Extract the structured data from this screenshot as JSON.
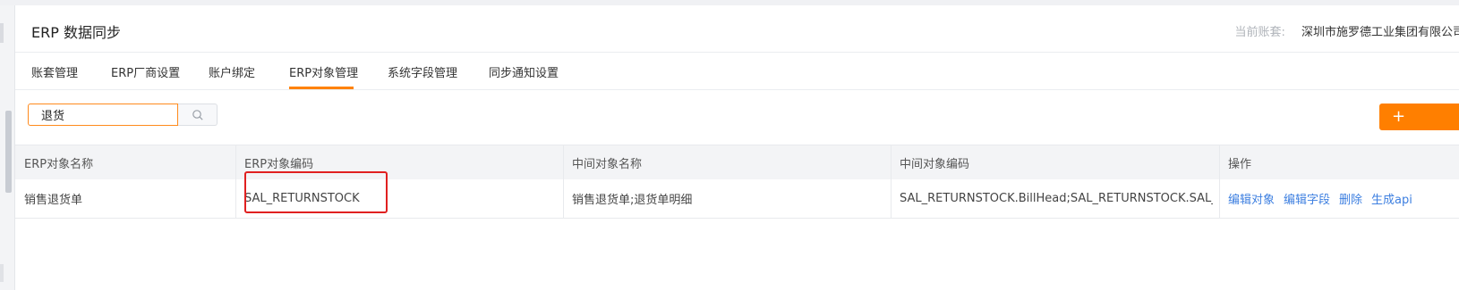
{
  "header": {
    "title": "ERP 数据同步",
    "account_label": "当前账套:",
    "account_value": "深圳市施罗德工业集团有限公司"
  },
  "tabs": [
    {
      "label": "账套管理"
    },
    {
      "label": "ERP厂商设置"
    },
    {
      "label": "账户绑定"
    },
    {
      "label": "ERP对象管理",
      "active": true
    },
    {
      "label": "系统字段管理"
    },
    {
      "label": "同步通知设置"
    }
  ],
  "search": {
    "value": "退货",
    "icon": "search-icon"
  },
  "add_button": {
    "label": "+"
  },
  "table": {
    "columns": [
      "ERP对象名称",
      "ERP对象编码",
      "中间对象名称",
      "中间对象编码",
      "操作"
    ],
    "rows": [
      {
        "erp_name": "销售退货单",
        "erp_code": "SAL_RETURNSTOCK",
        "mid_name": "销售退货单;退货单明细",
        "mid_code": "SAL_RETURNSTOCK.BillHead;SAL_RETURNSTOCK.SAL_RET...",
        "actions": [
          "编辑对象",
          "编辑字段",
          "删除",
          "生成api"
        ]
      }
    ]
  },
  "colors": {
    "accent": "#ff8200",
    "link": "#3d7fe0",
    "highlight": "#e02020"
  }
}
